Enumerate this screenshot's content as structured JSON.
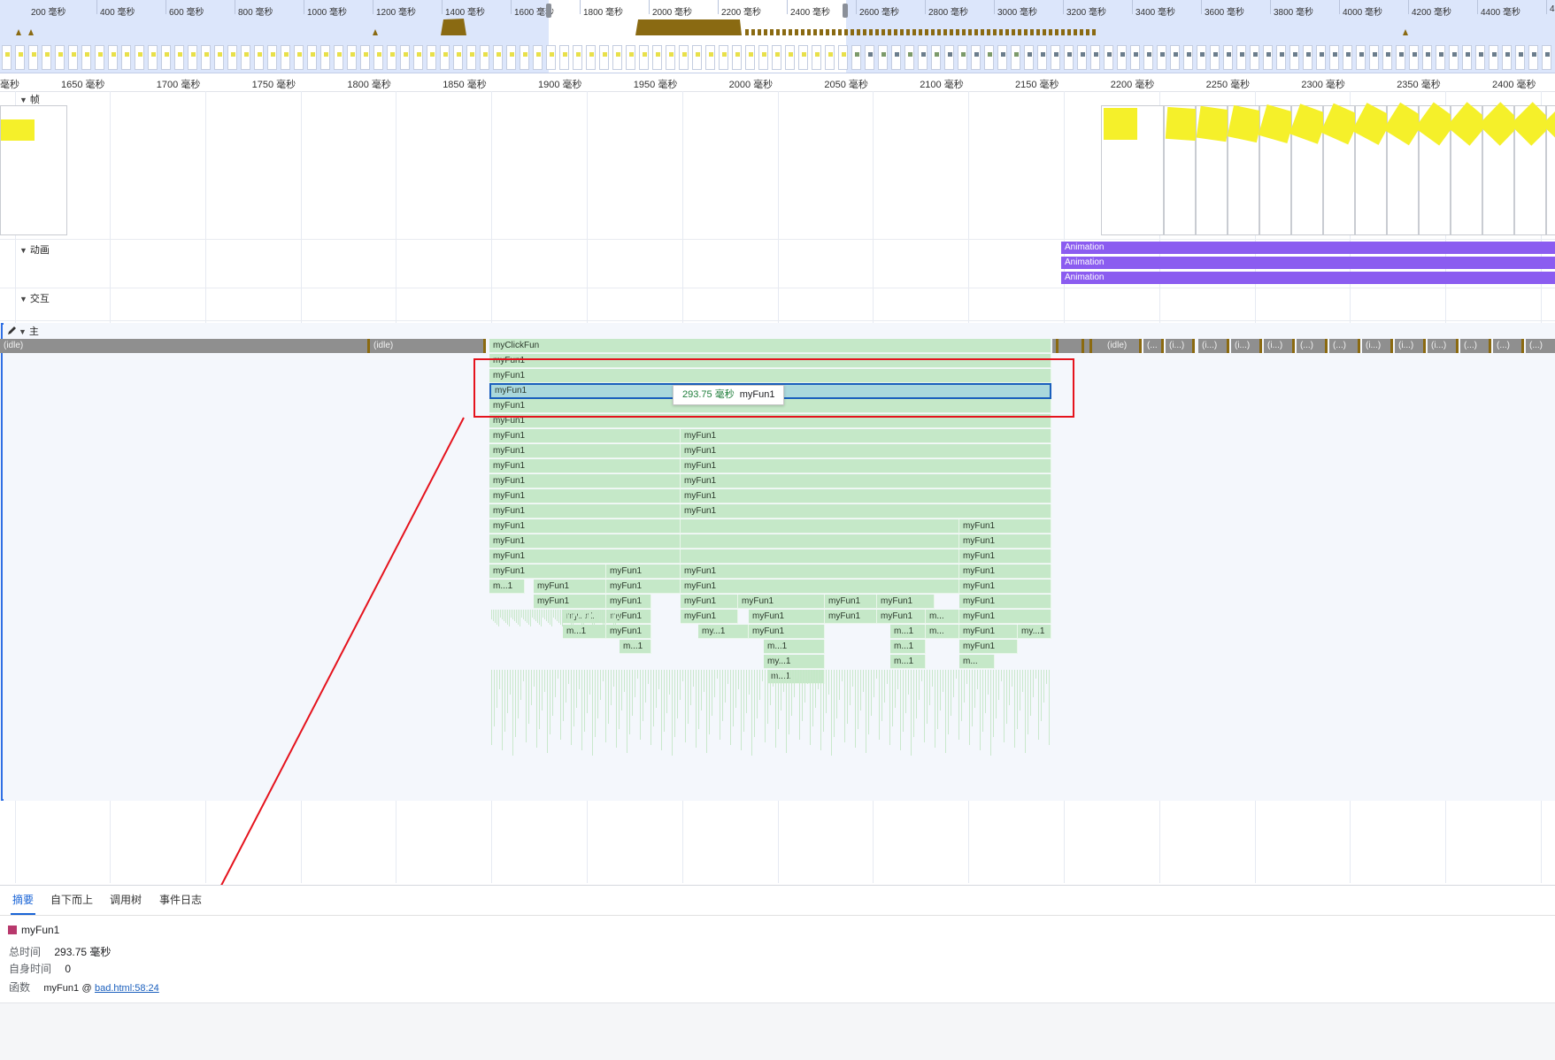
{
  "overview": {
    "ticks": [
      "200 毫秒",
      "400 毫秒",
      "600 毫秒",
      "800 毫秒",
      "1000 毫秒",
      "1200 毫秒",
      "1400 毫秒",
      "1600 毫秒",
      "1800 毫秒",
      "2000 毫秒",
      "2200 毫秒",
      "2400 毫秒",
      "2600 毫秒",
      "2800 毫秒",
      "3000 毫秒",
      "3200 毫秒",
      "3400 毫秒",
      "3600 毫秒",
      "3800 毫秒",
      "4000 毫秒",
      "4200 毫秒",
      "4400 毫秒",
      "46"
    ],
    "cpu_color": "#8a6a12",
    "window_color": "#ffffff"
  },
  "ruler": {
    "labels": [
      "毫秒",
      "1650 毫秒",
      "1700 毫秒",
      "1750 毫秒",
      "1800 毫秒",
      "1850 毫秒",
      "1900 毫秒",
      "1950 毫秒",
      "2000 毫秒",
      "2050 毫秒",
      "2100 毫秒",
      "2150 毫秒",
      "2200 毫秒",
      "2250 毫秒",
      "2300 毫秒",
      "2350 毫秒",
      "2400 毫秒"
    ]
  },
  "tracks": {
    "frames": "帧",
    "animations": "动画",
    "interactions": "交互",
    "main": "主"
  },
  "animations": {
    "bars": [
      "Animation",
      "Animation",
      "Animation"
    ],
    "color": "#8b5cf0"
  },
  "main": {
    "idle_labels": [
      "(idle)",
      "(idle)",
      "(idle)",
      "(...",
      "(i...)",
      "(i...)",
      "(i...)",
      "(i...)",
      "(...)",
      "(...)",
      "(i...)",
      "(i...)",
      "(i...)",
      "(...)",
      "(...)",
      "(...)"
    ],
    "root_call": "myClickFun",
    "call_name": "myFun1",
    "truncated": [
      "m...1",
      "my...n1",
      "m...",
      "m...1",
      "my...1",
      "m...1",
      "m...",
      "my...1",
      "m...1",
      "m...1",
      "my...1",
      "m..."
    ],
    "flame_color": "#c5e8c8",
    "idle_color": "#8f8f8f"
  },
  "tooltip": {
    "duration": "293.75 毫秒",
    "name": "myFun1"
  },
  "bottom": {
    "tabs": [
      "摘要",
      "自下而上",
      "调用树",
      "事件日志"
    ],
    "summary": {
      "title": "myFun1",
      "total_time_label": "总时间",
      "total_time_value": "293.75 毫秒",
      "self_time_label": "自身时间",
      "self_time_value": "0",
      "function_label": "函数",
      "function_name": "myFun1",
      "function_at": "@",
      "function_link": "bad.html:58:24"
    },
    "swatch_color": "#b8386c"
  },
  "annotation_color": "#e5131d"
}
